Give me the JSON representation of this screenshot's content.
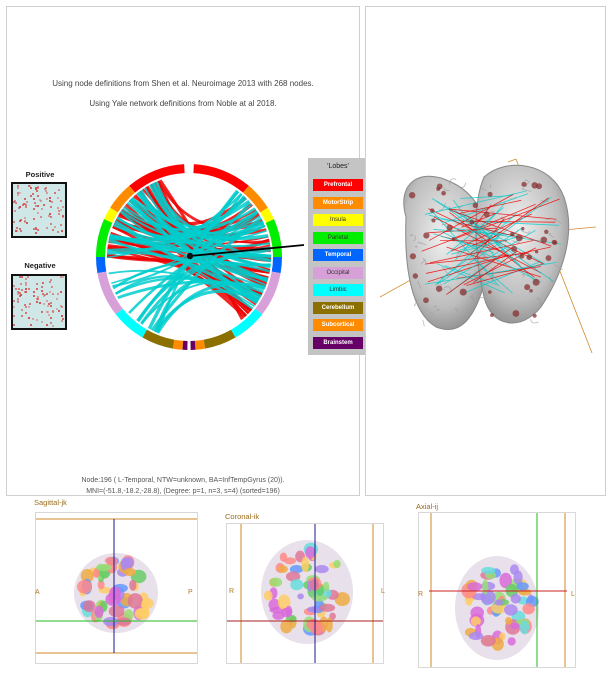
{
  "header": {
    "line1": "Using node definitions from Shen et al. Neuroimage 2013 with 268 nodes.",
    "line2": "Using Yale network definitions from Noble at al 2018."
  },
  "thumbnails": {
    "positive_label": "Positive",
    "negative_label": "Negative"
  },
  "legend": {
    "title": "'Lobes'",
    "items": [
      {
        "label": "Prefrontal",
        "color": "#ff0000",
        "text": "#ffffff"
      },
      {
        "label": "MotorStrip",
        "color": "#ff8c00",
        "text": "#ffffff"
      },
      {
        "label": "Insula",
        "color": "#ffff00",
        "text": "#333333"
      },
      {
        "label": "Parietal",
        "color": "#00ee00",
        "text": "#333333"
      },
      {
        "label": "Temporal",
        "color": "#0066ff",
        "text": "#ffffff"
      },
      {
        "label": "Occipital",
        "color": "#d8a0d8",
        "text": "#333333"
      },
      {
        "label": "Limbic",
        "color": "#00ffff",
        "text": "#333333"
      },
      {
        "label": "Cerebellum",
        "color": "#8b7000",
        "text": "#ffffff"
      },
      {
        "label": "Subcortical",
        "color": "#ff8c00",
        "text": "#ffffff"
      },
      {
        "label": "Brainstem",
        "color": "#660066",
        "text": "#ffffff"
      }
    ]
  },
  "footer": {
    "line1": "Node:196 ( L-Temporal, NTW=unknown, BA=InfTempGyrus (20)).",
    "line2": "MNI=(-51.8,-18.2,-28.8), (Degree: p=1, n=3, s=4)  (sorted=196)"
  },
  "slices": {
    "sagittal": {
      "title": "Sagittal-jk",
      "left": "A",
      "right": "P"
    },
    "coronal": {
      "title": "Coronal-ik",
      "left": "R",
      "right": "L"
    },
    "axial": {
      "title": "Axial-ij",
      "left": "R",
      "right": "L"
    }
  },
  "colors": {
    "positive_edge": "#ee0000",
    "negative_edge": "#00cccc",
    "selection_line": "#000000",
    "crosshair_orange": "#d08a2a"
  }
}
